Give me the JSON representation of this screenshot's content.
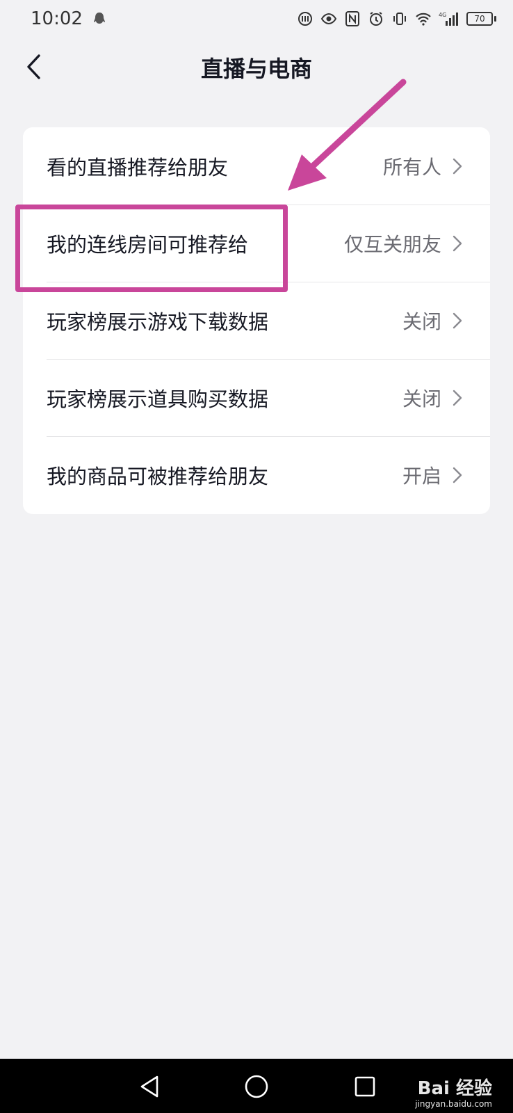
{
  "status_bar": {
    "time": "10:02",
    "battery": "70",
    "network": "4G",
    "icons": [
      "qq-icon",
      "hd-icon",
      "eye-icon",
      "nfc-icon",
      "alarm-icon",
      "vibrate-icon",
      "wifi-icon",
      "signal-icon",
      "battery-icon"
    ]
  },
  "header": {
    "title": "直播与电商",
    "back_icon": "chevron-left-icon"
  },
  "settings": {
    "rows": [
      {
        "label": "看的直播推荐给朋友",
        "value": "所有人"
      },
      {
        "label": "我的连线房间可推荐给",
        "value": "仅互关朋友"
      },
      {
        "label": "玩家榜展示游戏下载数据",
        "value": "关闭"
      },
      {
        "label": "玩家榜展示道具购买数据",
        "value": "关闭"
      },
      {
        "label": "我的商品可被推荐给朋友",
        "value": "开启"
      }
    ]
  },
  "annotation": {
    "color": "#c9469a"
  },
  "nav_bar": {
    "icons": [
      "nav-back-icon",
      "nav-home-icon",
      "nav-recent-icon"
    ]
  },
  "watermark": {
    "main": "Bai 经验",
    "sub": "jingyan.baidu.com"
  }
}
